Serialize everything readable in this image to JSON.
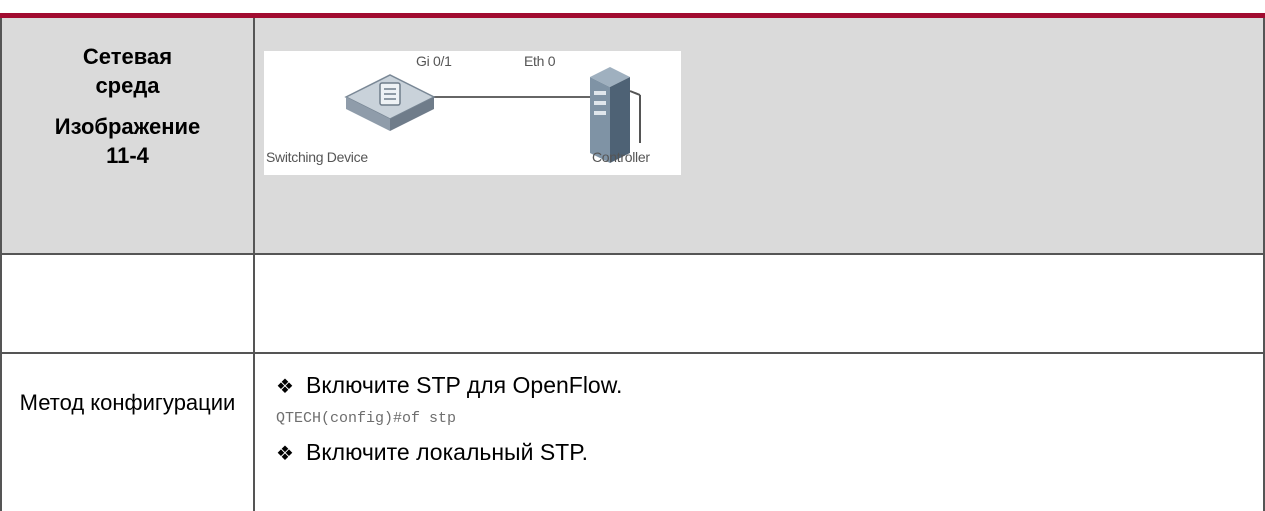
{
  "table": {
    "env_label_line1": "Сетевая среда",
    "env_label_line2": "Изображение 11-4",
    "method_label": "Метод конфигурации",
    "figure": {
      "port_switch": "Gi 0/1",
      "port_controller": "Eth 0",
      "switch_label": "Switching Device",
      "controller_label": "Controller",
      "switch_icon": "switch-icon",
      "server_icon": "server-icon"
    },
    "steps": [
      {
        "bullet": "❖",
        "text": "Включите STP для OpenFlow."
      },
      {
        "code": "QTECH(config)#of stp"
      },
      {
        "bullet": "❖",
        "text": "Включите локальный STP."
      }
    ]
  },
  "colors": {
    "header_rule": "#a10b30",
    "label_bg": "#dadada"
  }
}
